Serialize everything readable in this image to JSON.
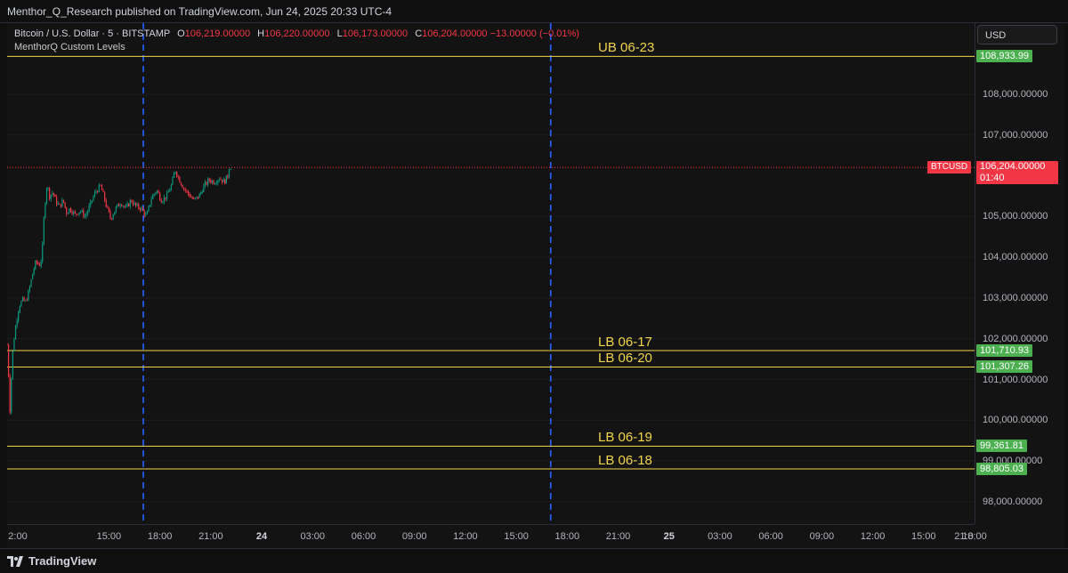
{
  "header": {
    "publisher_text": "Menthor_Q_Research published on TradingView.com, Jun 24, 2025 20:33 UTC-4"
  },
  "legend": {
    "symbol": "Bitcoin / U.S. Dollar · 5 · BITSTAMP",
    "open_key": "O",
    "open": "106,219.00000",
    "high_key": "H",
    "high": "106,220.00000",
    "low_key": "L",
    "low": "106,173.00000",
    "close_key": "C",
    "close": "106,204.00000",
    "change": "−13.00000 (−0.01%)",
    "indicator": "MenthorQ Custom Levels"
  },
  "currency": "USD",
  "price_axis": {
    "ticks": [
      "108,000.00000",
      "107,000.00000",
      "105,000.00000",
      "104,000.00000",
      "103,000.00000",
      "102,000.00000",
      "101,000.00000",
      "100,000.00000",
      "99,000.00000",
      "98,000.00000"
    ],
    "tick_values": [
      108000,
      107000,
      105000,
      104000,
      103000,
      102000,
      101000,
      100000,
      99000,
      98000
    ]
  },
  "time_axis": {
    "ticks": [
      "2:00",
      "15:00",
      "18:00",
      "21:00",
      "24",
      "03:00",
      "06:00",
      "09:00",
      "12:00",
      "15:00",
      "18:00",
      "21:00",
      "25",
      "03:00",
      "06:00",
      "09:00",
      "12:00",
      "15:00",
      "18:00",
      "21:0"
    ],
    "bold": [
      "24",
      "25"
    ]
  },
  "levels": [
    {
      "name": "UB 06-23",
      "value": 108933.99,
      "badge": "108,933.99"
    },
    {
      "name": "LB 06-17",
      "value": 101710.93,
      "badge": "101,710.93"
    },
    {
      "name": "LB 06-20",
      "value": 101307.26,
      "badge": "101,307.26"
    },
    {
      "name": "LB 06-19",
      "value": 99361.81,
      "badge": "99,361.81"
    },
    {
      "name": "LB 06-18",
      "value": 98805.03,
      "badge": "98,805.03"
    }
  ],
  "last_price": {
    "symbol_tag": "BTCUSD",
    "price": "106,204.00000",
    "countdown": "01:40",
    "value": 106204
  },
  "colors": {
    "level_line": "#f0d54a",
    "level_badge": "#4caf50",
    "up_candle": "#089981",
    "down_candle": "#f23645",
    "session_line": "#2962ff"
  },
  "footer": {
    "brand": "TradingView"
  },
  "chart_data": {
    "type": "candlestick",
    "title": "Bitcoin / U.S. Dollar · 5 · BITSTAMP",
    "ylim": [
      97450,
      109750
    ],
    "x_range": [
      "Jun 23 12:00",
      "Jun 25 21:00"
    ],
    "session_breaks": [
      "Jun 23 20:00",
      "Jun 24 20:00"
    ],
    "path": [
      [
        0,
        101850
      ],
      [
        0.05,
        101550
      ],
      [
        0.1,
        100900
      ],
      [
        0.15,
        100050
      ],
      [
        0.2,
        100650
      ],
      [
        0.35,
        101800
      ],
      [
        0.5,
        102300
      ],
      [
        0.7,
        102800
      ],
      [
        0.9,
        102950
      ],
      [
        1.1,
        102900
      ],
      [
        1.3,
        103200
      ],
      [
        1.5,
        103600
      ],
      [
        1.7,
        103900
      ],
      [
        1.9,
        103800
      ],
      [
        2.05,
        104000
      ],
      [
        2.2,
        105200
      ],
      [
        2.35,
        105800
      ],
      [
        2.5,
        105500
      ],
      [
        2.7,
        105600
      ],
      [
        2.9,
        105350
      ],
      [
        3.1,
        105250
      ],
      [
        3.3,
        105400
      ],
      [
        3.5,
        105100
      ],
      [
        3.7,
        105200
      ],
      [
        4.0,
        105050
      ],
      [
        4.3,
        105150
      ],
      [
        4.6,
        105000
      ],
      [
        4.9,
        105300
      ],
      [
        5.2,
        105600
      ],
      [
        5.5,
        105750
      ],
      [
        5.7,
        105500
      ],
      [
        5.85,
        105250
      ],
      [
        6.1,
        104950
      ],
      [
        6.4,
        105200
      ],
      [
        6.7,
        105350
      ],
      [
        7.0,
        105200
      ],
      [
        7.3,
        105400
      ],
      [
        7.6,
        105250
      ],
      [
        7.9,
        105200
      ],
      [
        8.2,
        105000
      ],
      [
        8.5,
        105450
      ],
      [
        8.8,
        105650
      ],
      [
        9.1,
        105400
      ],
      [
        9.4,
        105500
      ],
      [
        9.7,
        105800
      ],
      [
        9.9,
        106150
      ],
      [
        10.1,
        105950
      ],
      [
        10.4,
        105700
      ],
      [
        10.7,
        105550
      ],
      [
        11.0,
        105400
      ],
      [
        11.3,
        105500
      ],
      [
        11.6,
        105750
      ],
      [
        11.9,
        105900
      ],
      [
        12.2,
        105850
      ],
      [
        12.5,
        105950
      ],
      [
        12.8,
        105850
      ],
      [
        13.0,
        106000
      ],
      [
        13.1,
        106250
      ],
      [
        13.2,
        106204
      ]
    ]
  }
}
